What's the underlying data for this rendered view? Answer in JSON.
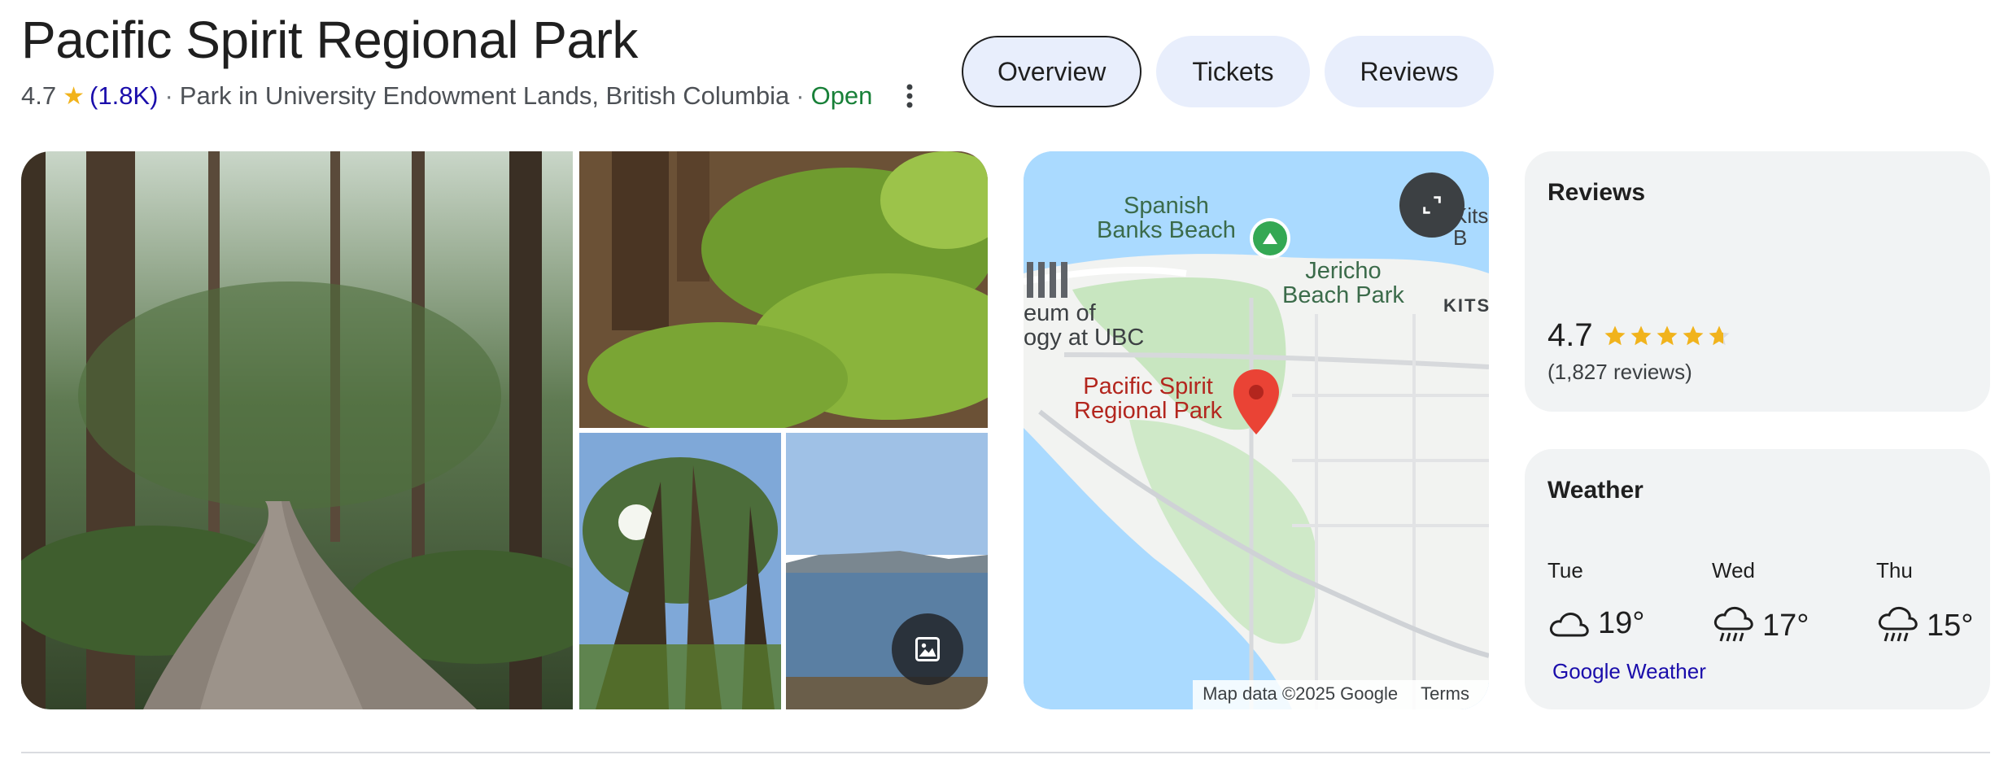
{
  "place": {
    "title": "Pacific Spirit Regional Park",
    "rating": "4.7",
    "review_count_short": "(1.8K)",
    "separator": "·",
    "category": "Park in University Endowment Lands, British Columbia",
    "status": "Open",
    "colors": {
      "open": "#188038",
      "star": "#f1b31c",
      "link": "#1a0dab"
    }
  },
  "tabs": [
    {
      "label": "Overview",
      "selected": true
    },
    {
      "label": "Tickets",
      "selected": false
    },
    {
      "label": "Reviews",
      "selected": false
    }
  ],
  "map": {
    "labels": {
      "spanish_banks": "Spanish\nBanks Beach",
      "jericho": "Jericho\nBeach Park",
      "kits": "KITS",
      "kits_edge": "Kits\nB",
      "museum": "eum of\nogy at UBC",
      "park": "Pacific Spirit\nRegional Park"
    },
    "attribution": "Map data ©2025 Google",
    "terms": "Terms"
  },
  "reviews_card": {
    "heading": "Reviews",
    "rating": "4.7",
    "stars": 4.7,
    "count": "(1,827 reviews)"
  },
  "weather_card": {
    "heading": "Weather",
    "days": [
      {
        "day": "Tue",
        "temp": "19°",
        "icon": "cloud-icon"
      },
      {
        "day": "Wed",
        "temp": "17°",
        "icon": "rain-icon"
      },
      {
        "day": "Thu",
        "temp": "15°",
        "icon": "rain-icon"
      }
    ],
    "source_link": "Google Weather"
  }
}
